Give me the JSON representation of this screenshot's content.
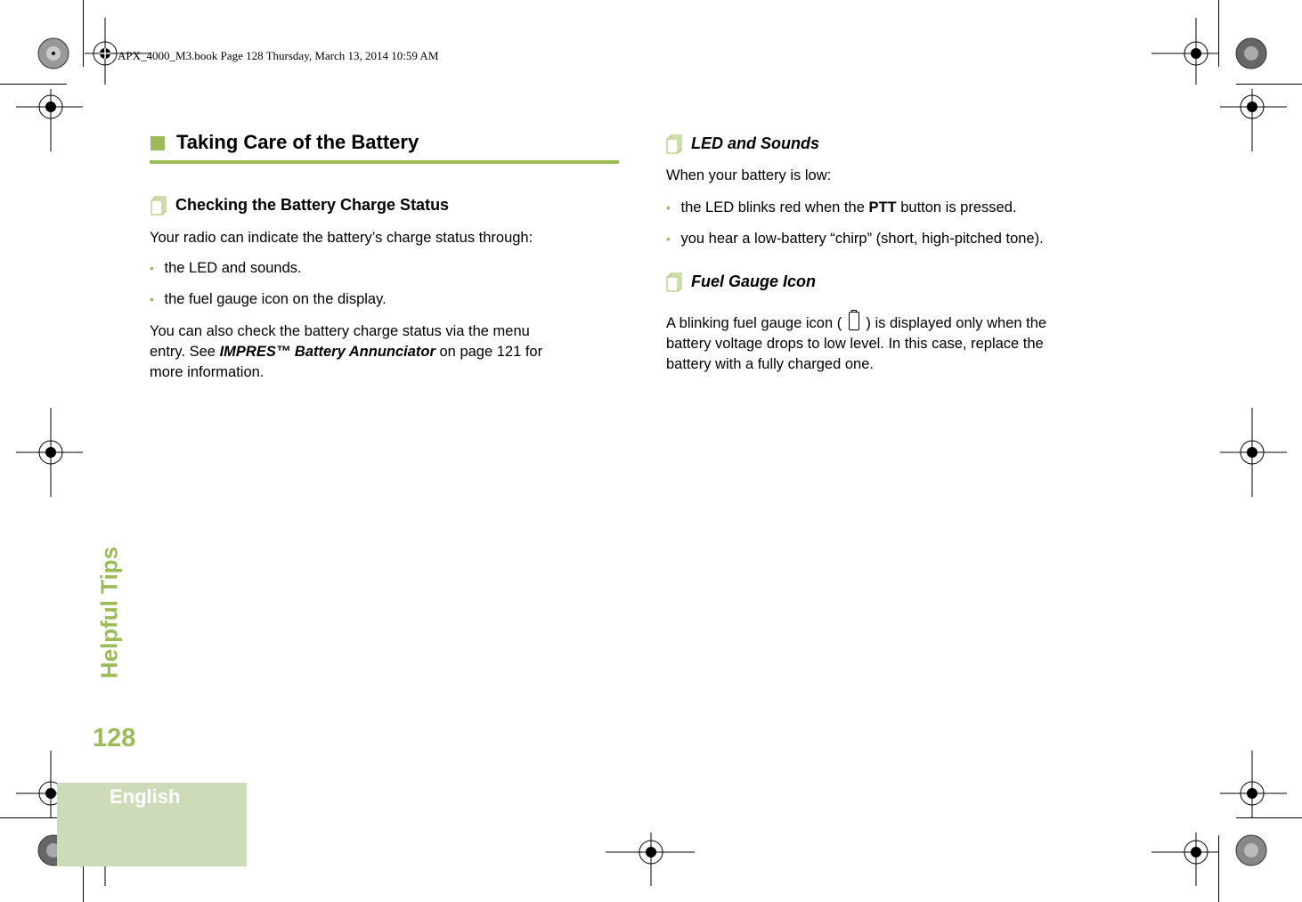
{
  "print_header": "APX_4000_M3.book  Page 128  Thursday, March 13, 2014  10:59 AM",
  "chapter_side_title": "Helpful Tips",
  "page_number": "128",
  "language_tab": "English",
  "accent_color": "#9bbb59",
  "section": {
    "title": "Taking Care of the Battery"
  },
  "left_column": {
    "subheading": "Checking the Battery Charge Status",
    "intro": "Your radio can indicate the battery’s charge status through:",
    "bullets": [
      "the LED and sounds.",
      "the fuel gauge icon on the display."
    ],
    "para_line1": "You can also check the battery charge status via the menu",
    "para_line2_prefix": "entry. See ",
    "para_line2_ref": "IMPRES™ Battery Annunciator",
    "para_line2_suffix": " on page 121 for",
    "para_line3": "more information."
  },
  "right_column": {
    "led_subheading": "LED and Sounds",
    "led_intro": "When your battery is low:",
    "led_bullet1_prefix": "the LED blinks red when the ",
    "led_bullet1_bold": "PTT",
    "led_bullet1_suffix": " button is pressed.",
    "led_bullet2": "you hear a low-battery “chirp” (short, high-pitched tone).",
    "fuel_subheading": "Fuel Gauge Icon",
    "fuel_line1_prefix": "A blinking fuel gauge icon ( ",
    "fuel_line1_suffix": " ) is displayed only when the",
    "fuel_line2": "battery voltage drops to low level. In this case, replace the",
    "fuel_line3": "battery with a fully charged one."
  }
}
